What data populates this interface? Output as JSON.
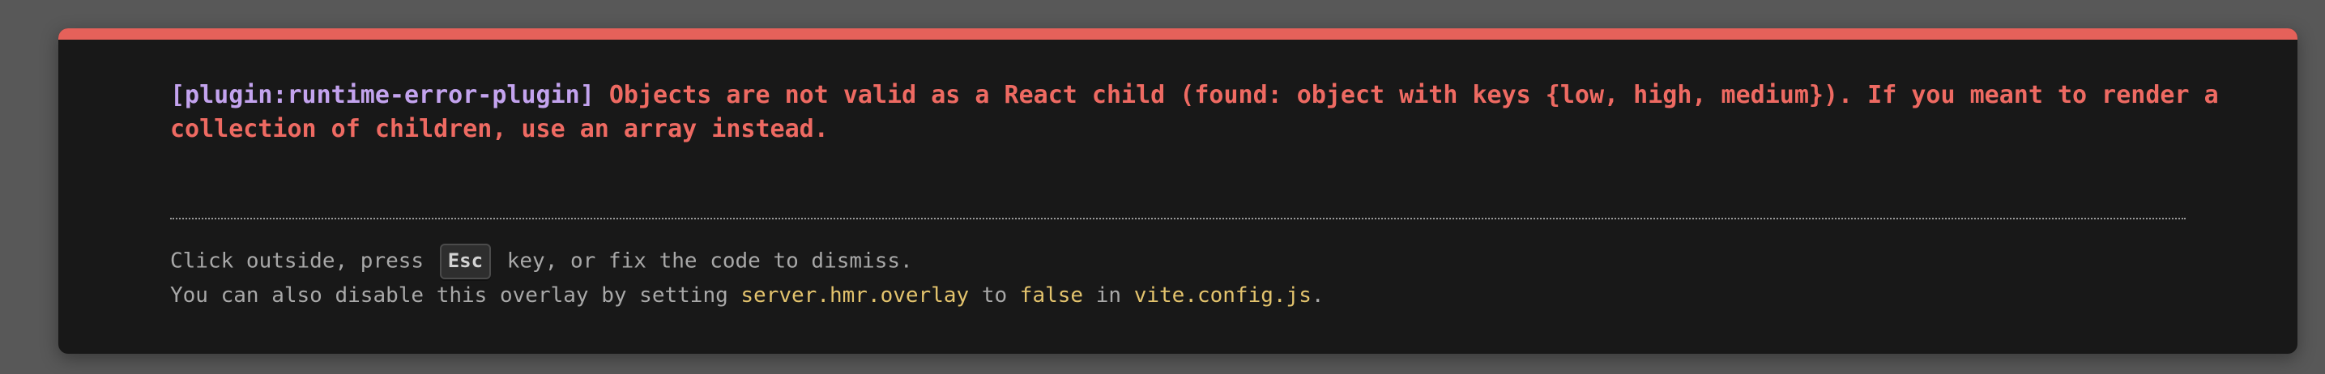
{
  "error": {
    "plugin": "[plugin:runtime-error-plugin]",
    "message": "Objects are not valid as a React child (found: object with keys {low, high, medium}). If you meant to render a collection of children, use an array instead."
  },
  "tip": {
    "line1_before": "Click outside, press",
    "key": "Esc",
    "line1_after": "key, or fix the code to dismiss.",
    "line2_before": "You can also disable this overlay by setting",
    "setting": "server.hmr.overlay",
    "line2_to": "to",
    "value": "false",
    "line2_in": "in",
    "config_file": "vite.config.js",
    "line2_end": "."
  },
  "colors": {
    "accent": "#e5615a",
    "error_text": "#ee6a62",
    "plugin_text": "#c3a3ee",
    "code_text": "#e3c36d",
    "background": "#181818"
  }
}
